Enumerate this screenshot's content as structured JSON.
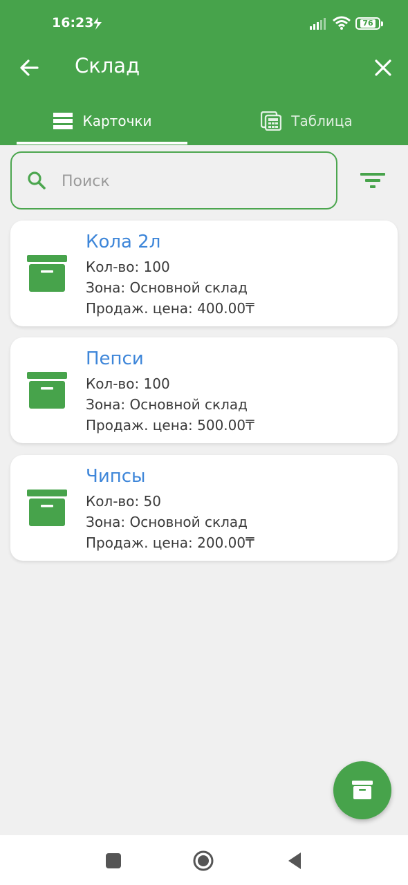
{
  "status_bar": {
    "time": "16:23",
    "battery": "76",
    "icons": [
      "app-notification-icon",
      "signal-icon",
      "wifi-icon",
      "battery-icon"
    ]
  },
  "header": {
    "title": "Склад",
    "back_icon": "arrow-left-icon",
    "close_icon": "close-icon"
  },
  "tabs": [
    {
      "label": "Карточки",
      "icon": "list-icon",
      "active": true
    },
    {
      "label": "Таблица",
      "icon": "table-icon",
      "active": false
    }
  ],
  "search": {
    "placeholder": "Поиск",
    "value": ""
  },
  "items": [
    {
      "name": "Кола 2л",
      "qty": "Кол-во: 100",
      "zone": "Зона: Основной склад",
      "price": "Продаж. цена: 400.00₸"
    },
    {
      "name": "Пепси",
      "qty": "Кол-во: 100",
      "zone": "Зона: Основной склад",
      "price": "Продаж. цена: 500.00₸"
    },
    {
      "name": "Чипсы",
      "qty": "Кол-во: 50",
      "zone": "Зона: Основной склад",
      "price": "Продаж. цена: 200.00₸"
    }
  ],
  "fab_icon": "archive-icon",
  "colors": {
    "primary": "#47a34b",
    "item_title": "#3e86d9",
    "background": "#f0f0f0"
  }
}
